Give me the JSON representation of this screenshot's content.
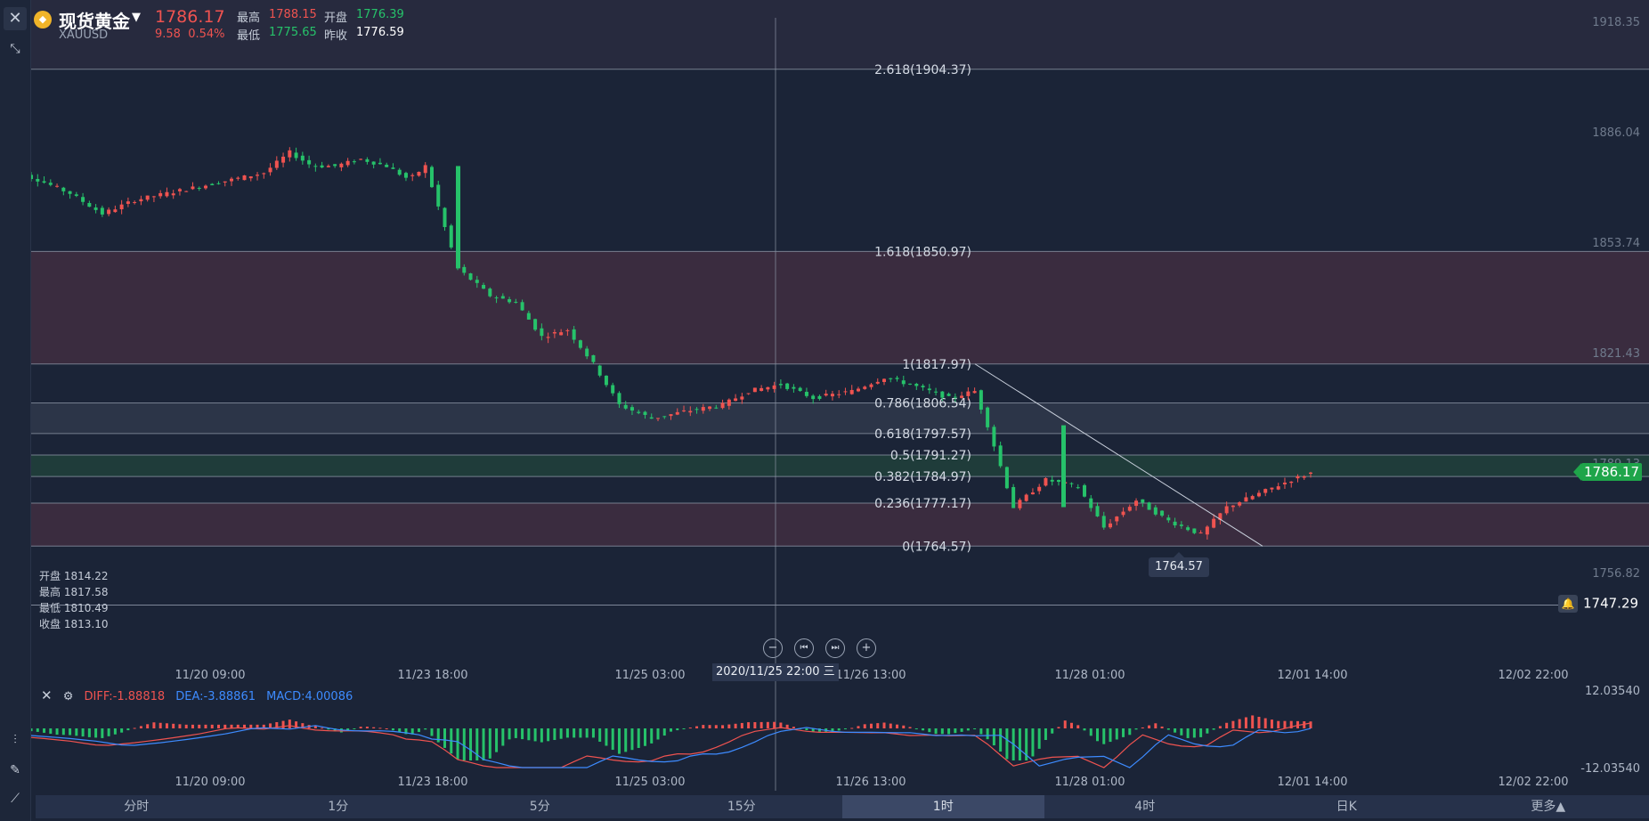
{
  "header": {
    "name": "现货黄金",
    "symbol": "XAUUSD",
    "price": "1786.17",
    "change": "9.58",
    "change_pct": "0.54%",
    "high_label": "最高",
    "high": "1788.15",
    "open_label": "开盘",
    "open": "1776.39",
    "low_label": "最低",
    "low": "1775.65",
    "prev_label": "昨收",
    "prev": "1776.59"
  },
  "fib_levels": [
    {
      "label": "2.618(1904.37)",
      "value": 1904.37
    },
    {
      "label": "1.618(1850.97)",
      "value": 1850.97
    },
    {
      "label": "1(1817.97)",
      "value": 1817.97
    },
    {
      "label": "0.786(1806.54)",
      "value": 1806.54
    },
    {
      "label": "0.618(1797.57)",
      "value": 1797.57
    },
    {
      "label": "0.5(1791.27)",
      "value": 1791.27
    },
    {
      "label": "0.382(1784.97)",
      "value": 1784.97
    },
    {
      "label": "0.236(1777.17)",
      "value": 1777.17
    },
    {
      "label": "0(1764.57)",
      "value": 1764.57
    }
  ],
  "price_axis": [
    "1918.35",
    "1886.04",
    "1853.74",
    "1821.43",
    "1789.13",
    "1756.82"
  ],
  "macd_axis": [
    "12.03540",
    "-12.03540"
  ],
  "time_axis": [
    "11/20 09:00",
    "11/23 18:00",
    "11/25 03:00",
    "11/26 13:00",
    "11/28 01:00",
    "12/01 14:00",
    "12/02 22:00"
  ],
  "left_edge_tick": "72",
  "crosshair_date": "2020/11/25 22:00 三",
  "current_price_tag": "1786.17",
  "alert_price": "1747.29",
  "low_marker": "1764.57",
  "ohlc_info": [
    {
      "label": "开盘",
      "value": "1814.22"
    },
    {
      "label": "最高",
      "value": "1817.58"
    },
    {
      "label": "最低",
      "value": "1810.49"
    },
    {
      "label": "收盘",
      "value": "1813.10"
    }
  ],
  "macd": {
    "diff": "DIFF:-1.88818",
    "dea": "DEA:-3.88861",
    "macd": "MACD:4.00086",
    "diff_color": "#ef5350",
    "dea_color": "#3d8bff",
    "macd_color": "#3d8bff"
  },
  "tabs": [
    "分时",
    "1分",
    "5分",
    "15分",
    "1时",
    "4时",
    "日K",
    "更多▲"
  ],
  "active_tab": "1时",
  "colors": {
    "up": "#ef5350",
    "down": "#26c26a",
    "grid_line": "#8a93a3",
    "band_red": "#3a2c3f",
    "band_green": "#1f3c3a"
  },
  "chart_data": {
    "type": "candlestick",
    "ylim": [
      1747.29,
      1918.35
    ],
    "x": [
      "11/20 09:00",
      "11/23 18:00",
      "11/25 03:00",
      "11/26 13:00",
      "11/28 01:00",
      "12/01 14:00",
      "12/02 22:00"
    ],
    "close_path": [
      [
        0,
        1875
      ],
      [
        10,
        1872
      ],
      [
        20,
        1868
      ],
      [
        30,
        1862
      ],
      [
        40,
        1866
      ],
      [
        50,
        1868
      ],
      [
        60,
        1870
      ],
      [
        70,
        1872
      ],
      [
        80,
        1874
      ],
      [
        88,
        1880
      ],
      [
        95,
        1876
      ],
      [
        102,
        1876
      ],
      [
        110,
        1878
      ],
      [
        118,
        1876
      ],
      [
        125,
        1872
      ],
      [
        130,
        1876
      ],
      [
        140,
        1846
      ],
      [
        150,
        1838
      ],
      [
        158,
        1836
      ],
      [
        166,
        1826
      ],
      [
        174,
        1828
      ],
      [
        182,
        1818
      ],
      [
        190,
        1806
      ],
      [
        200,
        1802
      ],
      [
        210,
        1804
      ],
      [
        222,
        1806
      ],
      [
        230,
        1810
      ],
      [
        240,
        1812
      ],
      [
        250,
        1808
      ],
      [
        262,
        1810
      ],
      [
        272,
        1814
      ],
      [
        280,
        1812
      ],
      [
        292,
        1808
      ],
      [
        300,
        1810
      ],
      [
        304,
        1800
      ],
      [
        312,
        1776
      ],
      [
        322,
        1784
      ],
      [
        332,
        1782
      ],
      [
        340,
        1770
      ],
      [
        350,
        1778
      ],
      [
        360,
        1772
      ],
      [
        370,
        1768
      ],
      [
        378,
        1776
      ],
      [
        388,
        1780
      ],
      [
        398,
        1784
      ],
      [
        404,
        1786
      ]
    ]
  }
}
